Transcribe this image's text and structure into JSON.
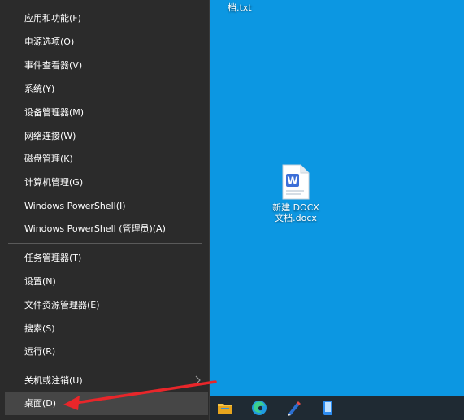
{
  "desktop": {
    "background_color": "#0c97e2",
    "top_file_label": "档.txt",
    "file": {
      "line1": "新建 DOCX",
      "line2": "文档.docx",
      "icon": "wps-writer-document-icon"
    }
  },
  "context_menu": {
    "items": [
      {
        "label": "应用和功能(F)"
      },
      {
        "label": "电源选项(O)"
      },
      {
        "label": "事件查看器(V)"
      },
      {
        "label": "系统(Y)"
      },
      {
        "label": "设备管理器(M)"
      },
      {
        "label": "网络连接(W)"
      },
      {
        "label": "磁盘管理(K)"
      },
      {
        "label": "计算机管理(G)"
      },
      {
        "label": "Windows PowerShell(I)"
      },
      {
        "label": "Windows PowerShell (管理员)(A)"
      },
      {
        "label": "任务管理器(T)"
      },
      {
        "label": "设置(N)"
      },
      {
        "label": "文件资源管理器(E)"
      },
      {
        "label": "搜索(S)"
      },
      {
        "label": "运行(R)"
      },
      {
        "label": "关机或注销(U)",
        "has_submenu": true
      },
      {
        "label": "桌面(D)",
        "selected": true
      }
    ]
  },
  "taskbar": {
    "icons": [
      "file-explorer-icon",
      "edge-browser-icon",
      "pen-app-icon",
      "phone-link-icon"
    ]
  },
  "annotation": {
    "color": "#e8262a",
    "target": "桌面(D)"
  }
}
